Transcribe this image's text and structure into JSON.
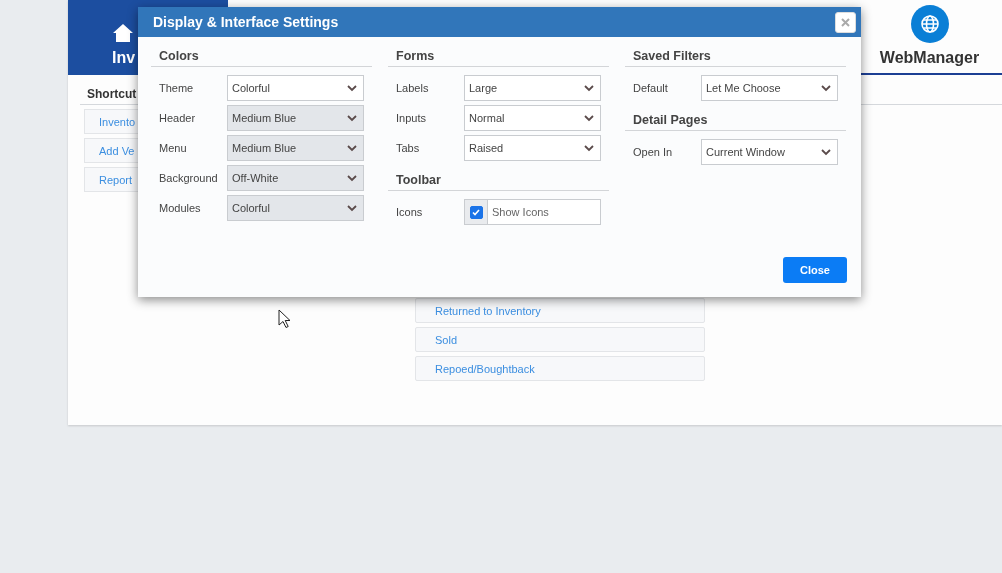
{
  "app": {
    "header_tabs": [
      {
        "label": "Inv",
        "selected": true
      },
      {
        "label": "WebManager",
        "selected": false
      }
    ],
    "shortcuts": {
      "title": "Shortcut",
      "items": [
        "Invento",
        "Add Ve",
        "Report"
      ]
    },
    "status_list": [
      "Returned to Inventory",
      "Sold",
      "Repoed/Boughtback"
    ]
  },
  "dialog": {
    "title": "Display & Interface Settings",
    "columns": [
      {
        "sections": [
          {
            "title": "Colors",
            "fields": [
              {
                "kind": "select",
                "label": "Theme",
                "value": "Colorful",
                "disabled": false
              },
              {
                "kind": "select",
                "label": "Header",
                "value": "Medium Blue",
                "disabled": true
              },
              {
                "kind": "select",
                "label": "Menu",
                "value": "Medium Blue",
                "disabled": true
              },
              {
                "kind": "select",
                "label": "Background",
                "value": "Off-White",
                "disabled": true
              },
              {
                "kind": "select",
                "label": "Modules",
                "value": "Colorful",
                "disabled": true
              }
            ]
          }
        ]
      },
      {
        "sections": [
          {
            "title": "Forms",
            "fields": [
              {
                "kind": "select",
                "label": "Labels",
                "value": "Large",
                "disabled": false
              },
              {
                "kind": "select",
                "label": "Inputs",
                "value": "Normal",
                "disabled": false
              },
              {
                "kind": "select",
                "label": "Tabs",
                "value": "Raised",
                "disabled": false
              }
            ]
          },
          {
            "title": "Toolbar",
            "fields": [
              {
                "kind": "checkbox",
                "label": "Icons",
                "value": "Show Icons",
                "checked": true
              }
            ]
          }
        ]
      },
      {
        "sections": [
          {
            "title": "Saved Filters",
            "fields": [
              {
                "kind": "select",
                "label": "Default",
                "value": "Let Me Choose",
                "disabled": false
              }
            ]
          },
          {
            "title": "Detail Pages",
            "fields": [
              {
                "kind": "select",
                "label": "Open In",
                "value": "Current Window",
                "disabled": false
              }
            ]
          }
        ]
      }
    ],
    "close_button": "Close"
  }
}
